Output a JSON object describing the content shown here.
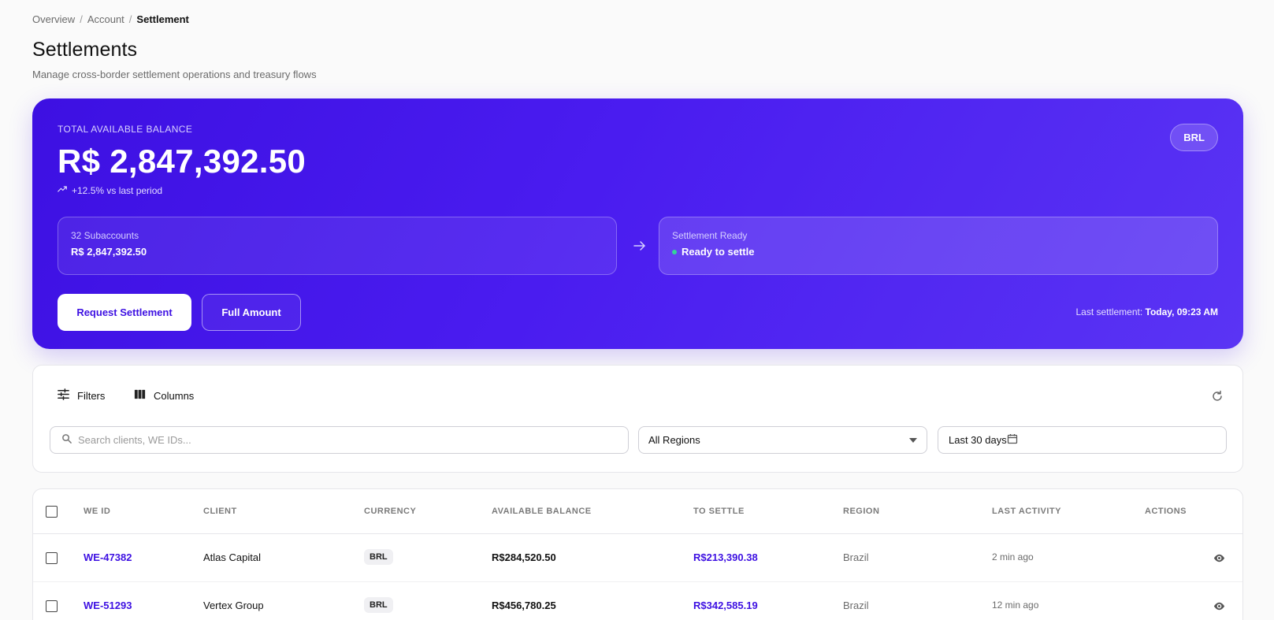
{
  "breadcrumb": [
    "Overview",
    "Account",
    "Settlement"
  ],
  "page": {
    "title": "Settlements",
    "subtitle": "Manage cross-border settlement operations and treasury flows"
  },
  "hero": {
    "label": "TOTAL AVAILABLE BALANCE",
    "balance": "R$ 2,847,392.50",
    "trend": "+12.5% vs last period",
    "currency": "BRL",
    "subaccounts": {
      "label": "32 Subaccounts",
      "value": "R$ 2,847,392.50"
    },
    "ready": {
      "label": "Settlement Ready",
      "value": "Ready to settle"
    },
    "request_button": "Request Settlement",
    "full_button": "Full Amount",
    "last_settlement_label": "Last settlement:",
    "last_settlement_value": "Today, 09:23 AM"
  },
  "filters": {
    "filters_label": "Filters",
    "columns_label": "Columns",
    "search_placeholder": "Search clients, WE IDs...",
    "region_selected": "All Regions",
    "date_range": "Last 30 days"
  },
  "table": {
    "headers": [
      "WE ID",
      "CLIENT",
      "CURRENCY",
      "AVAILABLE BALANCE",
      "TO SETTLE",
      "REGION",
      "LAST ACTIVITY",
      "ACTIONS"
    ],
    "rows": [
      {
        "we_id": "WE-47382",
        "client": "Atlas Capital",
        "currency": "BRL",
        "available": "R$284,520.50",
        "to_settle": "R$213,390.38",
        "region": "Brazil",
        "activity": "2 min ago"
      },
      {
        "we_id": "WE-51293",
        "client": "Vertex Group",
        "currency": "BRL",
        "available": "R$456,780.25",
        "to_settle": "R$342,585.19",
        "region": "Brazil",
        "activity": "12 min ago"
      }
    ]
  },
  "colors": {
    "brand": "#3d10e2",
    "status_ready": "#34d399"
  }
}
